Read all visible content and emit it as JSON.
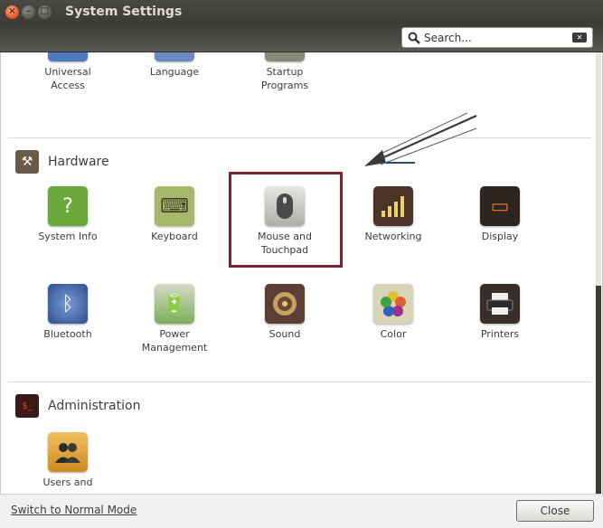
{
  "window": {
    "title": "System Settings",
    "controls": {
      "close": "×",
      "minimize": "–",
      "maximize": "□"
    }
  },
  "search": {
    "placeholder": "Search..."
  },
  "partial_items": [
    {
      "label": "Universal\nAccess"
    },
    {
      "label": "Language"
    },
    {
      "label": "Startup\nPrograms"
    }
  ],
  "sections": [
    {
      "title": "Hardware",
      "icon": "hardware-icon",
      "items": [
        {
          "label": "System Info",
          "icon": "system-info-icon",
          "color": "#6aa83a"
        },
        {
          "label": "Keyboard",
          "icon": "keyboard-icon",
          "color": "#a8b86a"
        },
        {
          "label": "Mouse and\nTouchpad",
          "icon": "mouse-icon",
          "color": "#3a3a3a"
        },
        {
          "label": "Networking",
          "icon": "networking-icon",
          "color": "#5a3a2a"
        },
        {
          "label": "Display",
          "icon": "display-icon",
          "color": "#3a2a24"
        },
        {
          "label": "Bluetooth",
          "icon": "bluetooth-icon",
          "color": "#3d5fa0"
        },
        {
          "label": "Power\nManagement",
          "icon": "power-management-icon",
          "color": "#7ab05a"
        },
        {
          "label": "Sound",
          "icon": "sound-icon",
          "color": "#6a5040"
        },
        {
          "label": "Color",
          "icon": "color-icon",
          "color": "#b8c070"
        },
        {
          "label": "Printers",
          "icon": "printer-icon",
          "color": "#4a3a30"
        }
      ]
    },
    {
      "title": "Administration",
      "icon": "administration-icon",
      "items": [
        {
          "label": "Users and",
          "icon": "users-icon",
          "color": "#d99a3a"
        }
      ]
    }
  ],
  "footer": {
    "mode_link": "Switch to Normal Mode",
    "close_label": "Close"
  },
  "annotation": {
    "highlighted_item": "Mouse and Touchpad",
    "arrow_color": "#3a3a3a",
    "box_color": "#7a2430"
  }
}
